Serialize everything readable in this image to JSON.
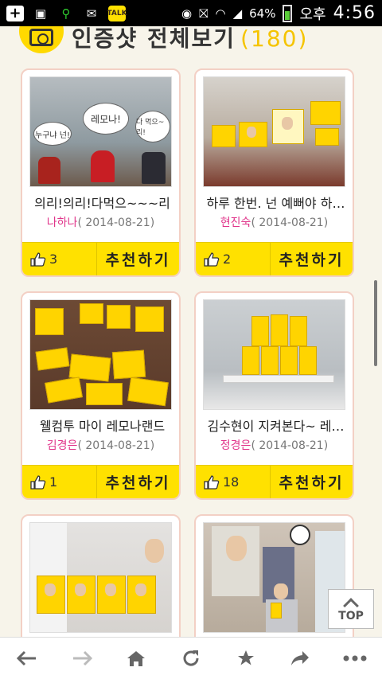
{
  "statusbar": {
    "battery": "64%",
    "ampm": "오후",
    "time": "4:56"
  },
  "header": {
    "title": "인증샷 전체보기",
    "count": "(180)"
  },
  "cards": [
    {
      "title": "의리!의리!다먹으~~~리",
      "author": "나하나",
      "date": "( 2014-08-21)",
      "likes": "3",
      "recommend": "추천하기",
      "bubbles": [
        "누구냐 넌!",
        "레모나!",
        "다 먹으~리!"
      ]
    },
    {
      "title": "하루 한번. 넌 예뻐야 하…",
      "author": "현진숙",
      "date": "( 2014-08-21)",
      "likes": "2",
      "recommend": "추천하기"
    },
    {
      "title": "웰컴투 마이 레모나랜드",
      "author": "김경은",
      "date": "( 2014-08-21)",
      "likes": "1",
      "recommend": "추천하기"
    },
    {
      "title": "김수현이 지켜본다~ 레…",
      "author": "정경은",
      "date": "( 2014-08-21)",
      "likes": "18",
      "recommend": "추천하기"
    },
    {
      "title": "",
      "author": "",
      "date": "",
      "likes": "",
      "recommend": ""
    },
    {
      "title": "",
      "author": "",
      "date": "",
      "likes": "",
      "recommend": ""
    }
  ],
  "topbutton": {
    "label": "TOP"
  },
  "nav": {
    "back_icon": "back-arrow-icon",
    "forward_icon": "forward-arrow-icon",
    "home_icon": "home-icon",
    "reload_icon": "reload-icon",
    "bookmark_icon": "star-icon",
    "share_icon": "share-icon",
    "menu_icon": "more-icon"
  },
  "colors": {
    "accent": "#ffe100",
    "author": "#e0348a",
    "card_border": "#f3d0c5"
  }
}
